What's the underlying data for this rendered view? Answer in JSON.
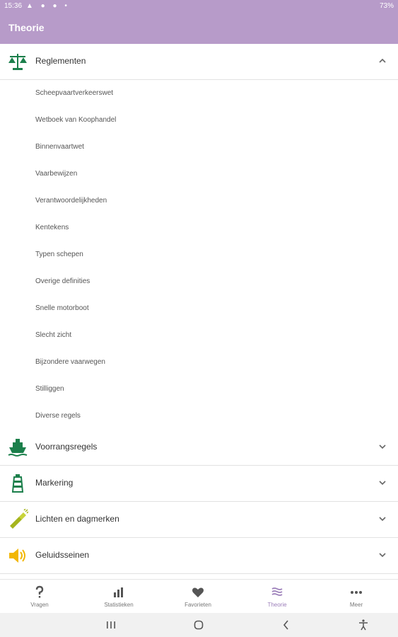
{
  "status": {
    "time": "15:36",
    "battery": "73%"
  },
  "appbar": {
    "title": "Theorie"
  },
  "sections": [
    {
      "label": "Reglementen",
      "icon": "scales-icon",
      "expanded": true,
      "items": [
        "Scheepvaartverkeerswet",
        "Wetboek van Koophandel",
        "Binnenvaartwet",
        "Vaarbewijzen",
        "Verantwoordelijkheden",
        "Kentekens",
        "Typen schepen",
        "Overige definities",
        "Snelle motorboot",
        "Slecht zicht",
        "Bijzondere vaarwegen",
        "Stilliggen",
        "Diverse regels"
      ]
    },
    {
      "label": "Voorrangsregels",
      "icon": "ship-icon",
      "expanded": false
    },
    {
      "label": "Markering",
      "icon": "lighthouse-icon",
      "expanded": false
    },
    {
      "label": "Lichten en dagmerken",
      "icon": "flashlight-icon",
      "expanded": false
    },
    {
      "label": "Geluidsseinen",
      "icon": "speaker-icon",
      "expanded": false
    }
  ],
  "bottom_nav": [
    {
      "label": "Vragen",
      "icon": "question-icon"
    },
    {
      "label": "Statistieken",
      "icon": "bar-chart-icon"
    },
    {
      "label": "Favorieten",
      "icon": "heart-icon"
    },
    {
      "label": "Theorie",
      "icon": "waves-icon",
      "active": true
    },
    {
      "label": "Meer",
      "icon": "more-icon"
    }
  ],
  "colors": {
    "accent": "#b79bc9",
    "active": "#9c7fba",
    "green": "#1b7f4b",
    "yellow": "#f2b705"
  }
}
